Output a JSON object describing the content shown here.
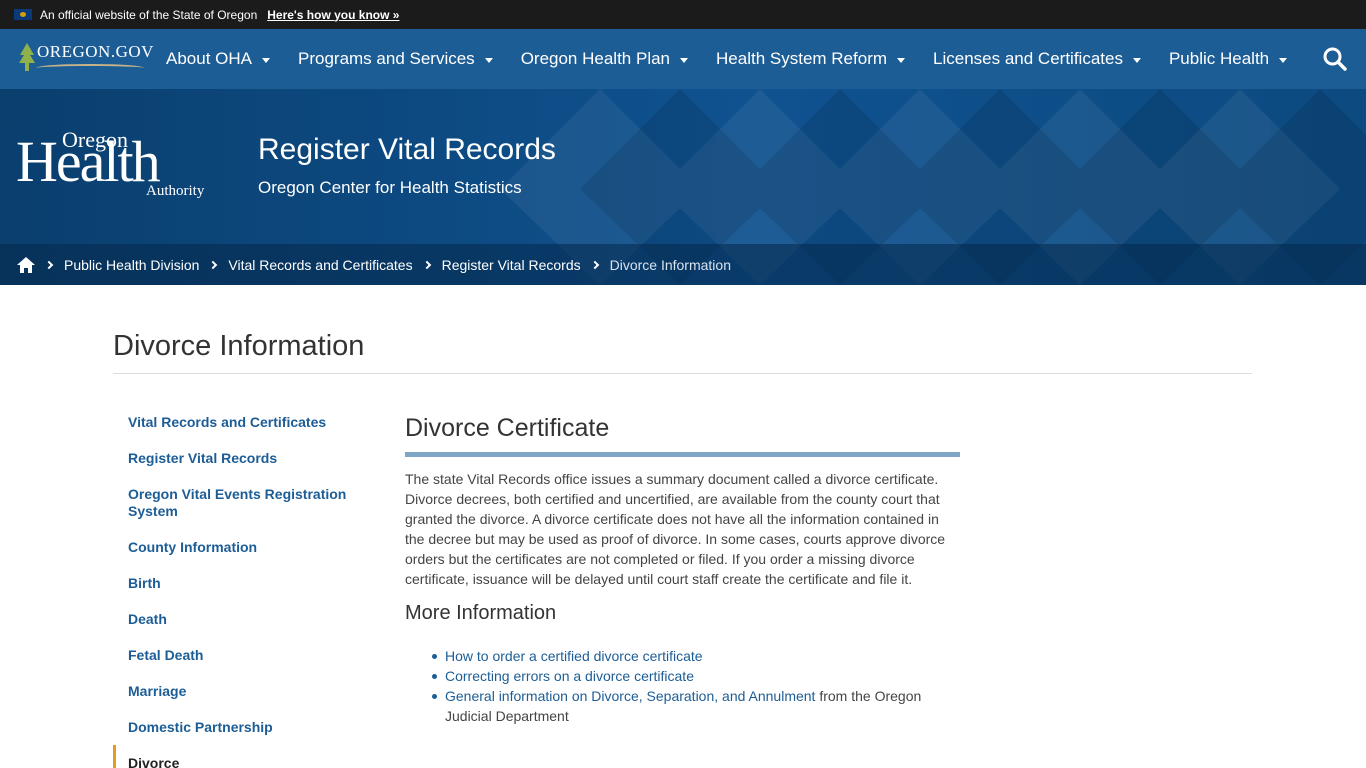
{
  "official_bar": {
    "text": "An official website of the State of Oregon",
    "link": "Here's how you know »"
  },
  "nav": {
    "logo_text": "Oregon.gov",
    "items": [
      {
        "label": "About OHA"
      },
      {
        "label": "Programs and Services"
      },
      {
        "label": "Oregon Health Plan"
      },
      {
        "label": "Health System Reform"
      },
      {
        "label": "Licenses and Certificates"
      },
      {
        "label": "Public Health"
      }
    ]
  },
  "banner": {
    "logo": {
      "line1": "Oregon",
      "line2": "Health",
      "line3": "Authority"
    },
    "title": "Register Vital Records",
    "subtitle": "Oregon Center for Health Statistics"
  },
  "breadcrumb": {
    "items": [
      "Public Health Division",
      "Vital Records and Certificates",
      "Register Vital Records"
    ],
    "current": "Divorce Information"
  },
  "page": {
    "title": "Divorce Information"
  },
  "side_nav": {
    "items": [
      {
        "label": "Vital Records and Certificates"
      },
      {
        "label": "Register Vital Records"
      },
      {
        "label": "Oregon Vital Events Registration System"
      },
      {
        "label": "County Information"
      },
      {
        "label": "Birth"
      },
      {
        "label": "Death"
      },
      {
        "label": "Fetal Death"
      },
      {
        "label": "Marriage"
      },
      {
        "label": "Domestic Partnership"
      },
      {
        "label": "Divorce"
      }
    ]
  },
  "content": {
    "heading": "Divorce Certificate",
    "paragraph": "The state Vital Records office issues a summary document called a divorce certificate. Divorce decrees, both certified and uncertified, are available from the county court that granted the divorce. A divorce certificate does not have all the information contained in the decree but may be used as proof of divorce. In some cases, courts approve divorce orders but the certificates are not completed or filed. If you order a missing divorce certificate, issuance will be delayed until court staff create the certificate and file it.",
    "more_heading": "More Information",
    "links": [
      {
        "link": "How to order a certified divorce certificate",
        "suffix": ""
      },
      {
        "link": "Correcting errors on a divorce certificate",
        "suffix": ""
      },
      {
        "link": "General information on Divorce, Separation, and Annulment",
        "suffix": " from the Oregon Judicial Department"
      }
    ]
  },
  "colors": {
    "nav_bg": "#1d5d96",
    "banner_bg": "#0c4a7e",
    "accent": "#e69b1e",
    "link": "#1d5d96"
  }
}
